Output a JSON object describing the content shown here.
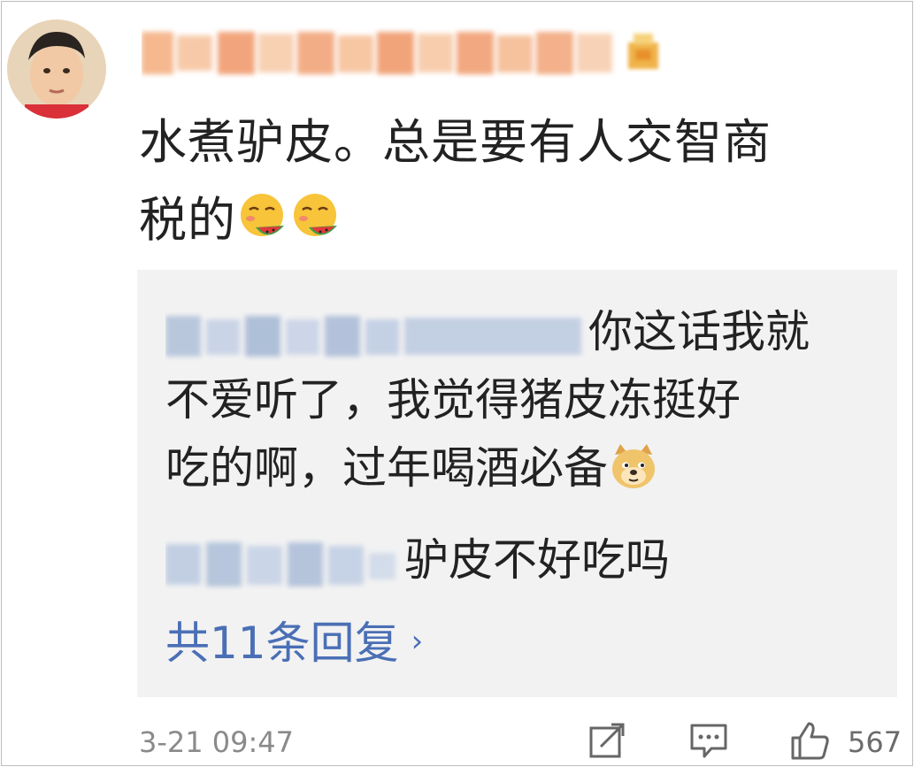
{
  "comment": {
    "text_line1": "水煮驴皮。总是要有人交智商",
    "text_line2": "税的",
    "emojis": [
      "watermelon-face-emoji",
      "watermelon-face-emoji"
    ]
  },
  "replies": [
    {
      "line1": "你这话我就",
      "line2": "不爱听了，我觉得猪皮冻挺好",
      "line3": "吃的啊，过年喝酒必备",
      "emoji": "doge-emoji"
    },
    {
      "text": "驴皮不好吃吗"
    }
  ],
  "more_replies_label": "共11条回复",
  "more_chevron": "›",
  "timestamp": "3-21 09:47",
  "like_count": "567",
  "colors": {
    "link": "#4a6fb5",
    "reply_bg": "#f2f2f2",
    "muted": "#8a8a8a"
  }
}
